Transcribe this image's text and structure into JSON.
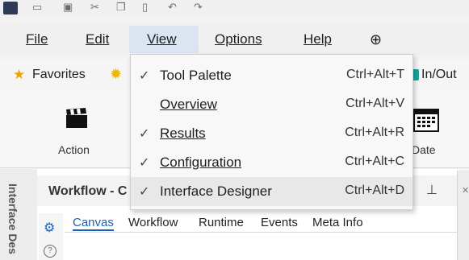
{
  "menubar": {
    "items": [
      "File",
      "Edit",
      "View",
      "Options",
      "Help"
    ],
    "active": "View"
  },
  "favorites": {
    "label": "Favorites",
    "right_label": "In/Out"
  },
  "ribbon": {
    "action_label": "Action",
    "date_label": "Date"
  },
  "workflow": {
    "title": "Workflow - C",
    "side_label": "Interface Des",
    "tabs": [
      "Canvas",
      "Workflow",
      "Runtime",
      "Events",
      "Meta Info"
    ],
    "selected_tab": "Canvas"
  },
  "view_menu": {
    "items": [
      {
        "label": "Tool Palette",
        "shortcut": "Ctrl+Alt+T",
        "checked": true
      },
      {
        "label": "Overview",
        "shortcut": "Ctrl+Alt+V",
        "checked": false
      },
      {
        "label": "Results",
        "shortcut": "Ctrl+Alt+R",
        "checked": true
      },
      {
        "label": "Configuration",
        "shortcut": "Ctrl+Alt+C",
        "checked": true
      },
      {
        "label": "Interface Designer",
        "shortcut": "Ctrl+Alt+D",
        "checked": true,
        "highlighted": true
      }
    ]
  },
  "colors": {
    "accent": "#1a5fb4",
    "menu_active_bg": "#dbe5f1",
    "star": "#f2a100"
  }
}
